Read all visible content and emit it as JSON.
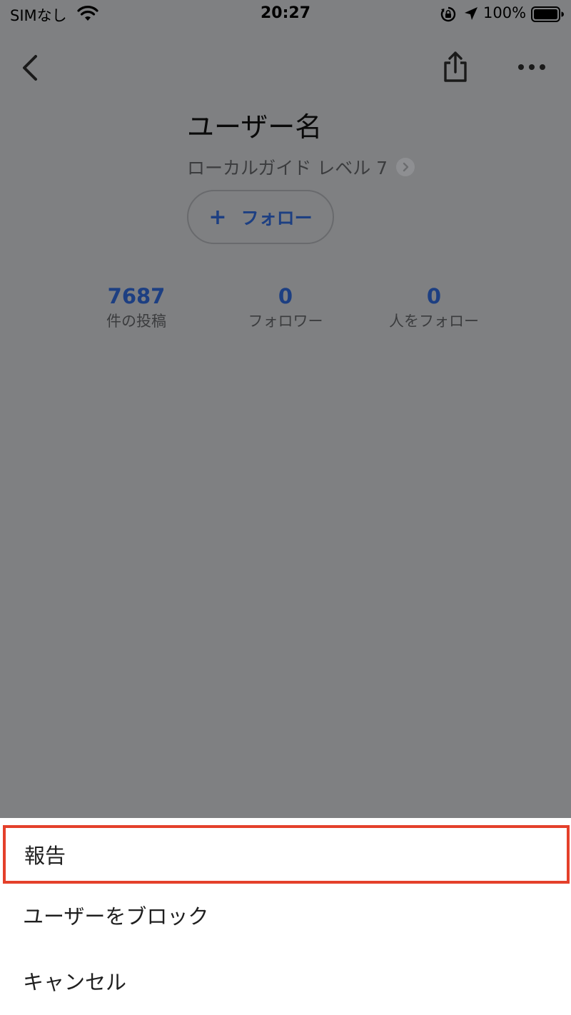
{
  "status_bar": {
    "carrier": "SIMなし",
    "time": "20:27",
    "battery": "100%"
  },
  "profile": {
    "name": "ユーザー名",
    "level": "ローカルガイド レベル 7",
    "follow_label": "フォロー",
    "plus_symbol": "+"
  },
  "stats": [
    {
      "value": "7687",
      "label": "件の投稿"
    },
    {
      "value": "0",
      "label": "フォロワー"
    },
    {
      "value": "0",
      "label": "人をフォロー"
    }
  ],
  "action_sheet": {
    "items": [
      {
        "label": "報告"
      },
      {
        "label": "ユーザーをブロック"
      },
      {
        "label": "キャンセル"
      }
    ],
    "highlight_color": "#e4402b"
  },
  "colors": {
    "accent": "#1d3f82",
    "overlay": "#7f8082"
  }
}
